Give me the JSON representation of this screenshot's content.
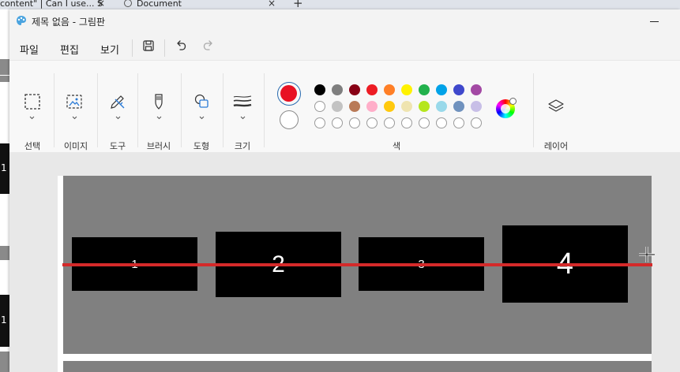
{
  "browser": {
    "tabs": [
      {
        "label": "content\" | Can I use... S"
      },
      {
        "label": "Document"
      }
    ],
    "close_glyph": "×",
    "new_tab_glyph": "+"
  },
  "background_window": {
    "block_labels": [
      "1",
      "1"
    ]
  },
  "window": {
    "title": "제목 없음 - 그림판",
    "app_icon": "paint-palette-icon"
  },
  "menu": {
    "items": [
      "파일",
      "편집",
      "보기"
    ],
    "icons": [
      "save-icon",
      "undo-icon",
      "redo-icon"
    ]
  },
  "ribbon": {
    "groups": [
      "선택",
      "이미지",
      "도구",
      "브러시",
      "도형",
      "크기"
    ],
    "colors_label": "색",
    "layers_label": "레이어",
    "primary_color": "#e81123",
    "secondary_color": "#ffffff",
    "palette_row1": [
      "#000000",
      "#7f7f7f",
      "#880015",
      "#ed1c24",
      "#ff7f27",
      "#fff200",
      "#22b14c",
      "#00a2e8",
      "#3f48cc",
      "#a349a4"
    ],
    "palette_row2": [
      "#ffffff",
      "#c3c3c3",
      "#b97a57",
      "#ffaec9",
      "#ffc90e",
      "#efe4b0",
      "#b5e61d",
      "#99d9ea",
      "#7092be",
      "#c8bfe7"
    ],
    "custom_slots": 10
  },
  "canvas": {
    "background": "#808080",
    "line_color": "#d42a2a",
    "boxes": [
      "1",
      "2",
      "3",
      "4"
    ]
  }
}
